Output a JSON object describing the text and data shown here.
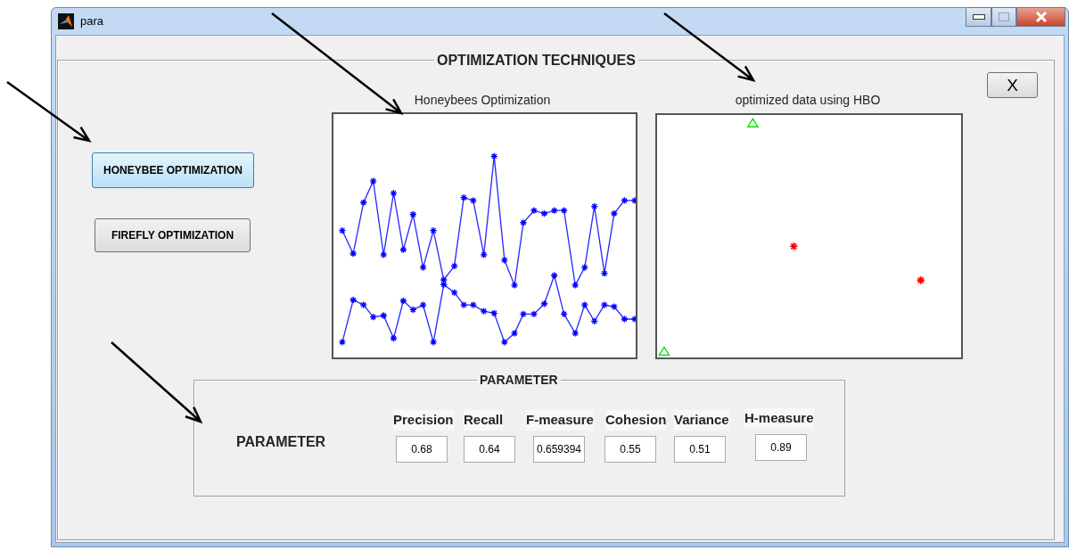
{
  "window": {
    "title": "para"
  },
  "panel": {
    "title": "OPTIMIZATION TECHNIQUES"
  },
  "close_button": {
    "label": "X"
  },
  "buttons": [
    {
      "label": "HONEYBEE OPTIMIZATION",
      "selected": true
    },
    {
      "label": "FIREFLY OPTIMIZATION",
      "selected": false
    }
  ],
  "plots": [
    {
      "title": "Honeybees Optimization",
      "kind": "line"
    },
    {
      "title": "optimized data using HBO",
      "kind": "scatter"
    }
  ],
  "parameter_panel": {
    "title": "PARAMETER",
    "label": "PARAMETER",
    "fields": [
      {
        "label": "Precision",
        "value": "0.68"
      },
      {
        "label": "Recall",
        "value": "0.64"
      },
      {
        "label": "F-measure",
        "value": "0.659394"
      },
      {
        "label": "Cohesion",
        "value": "0.55"
      },
      {
        "label": "Variance",
        "value": "0.51"
      },
      {
        "label": "H-measure",
        "value": "0.89"
      }
    ]
  }
}
